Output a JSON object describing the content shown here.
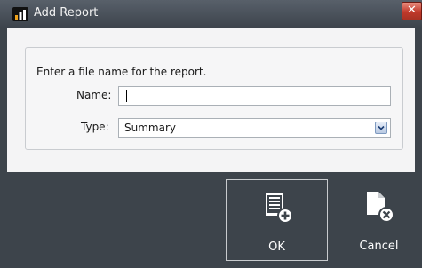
{
  "window": {
    "title": "Add Report",
    "close_symbol": "✕",
    "app_icon": "bar-chart-icon",
    "colors": {
      "titlebar": "#4a5159",
      "footer": "#3d444b",
      "close": "#c0392b"
    }
  },
  "form": {
    "instruction": "Enter a file name for the report.",
    "name_label": "Name:",
    "name_value": "",
    "type_label": "Type:",
    "type_value": "Summary"
  },
  "buttons": {
    "ok_label": "OK",
    "ok_icon": "add-document-icon",
    "cancel_label": "Cancel",
    "cancel_icon": "remove-document-icon"
  }
}
